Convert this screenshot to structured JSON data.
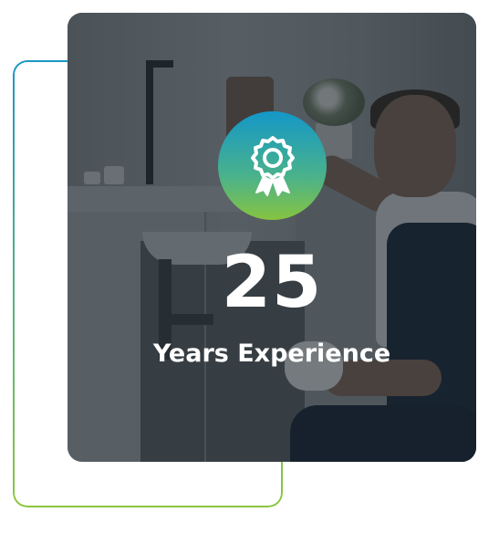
{
  "experience": {
    "number": "25",
    "label": "Years Experience",
    "badge_icon": "award-ribbon-icon"
  },
  "colors": {
    "gradient_start": "#1497c8",
    "gradient_end": "#86c440",
    "text": "#ffffff",
    "overlay": "#141e24"
  },
  "photo": {
    "subject": "plumber-fixing-sink"
  }
}
